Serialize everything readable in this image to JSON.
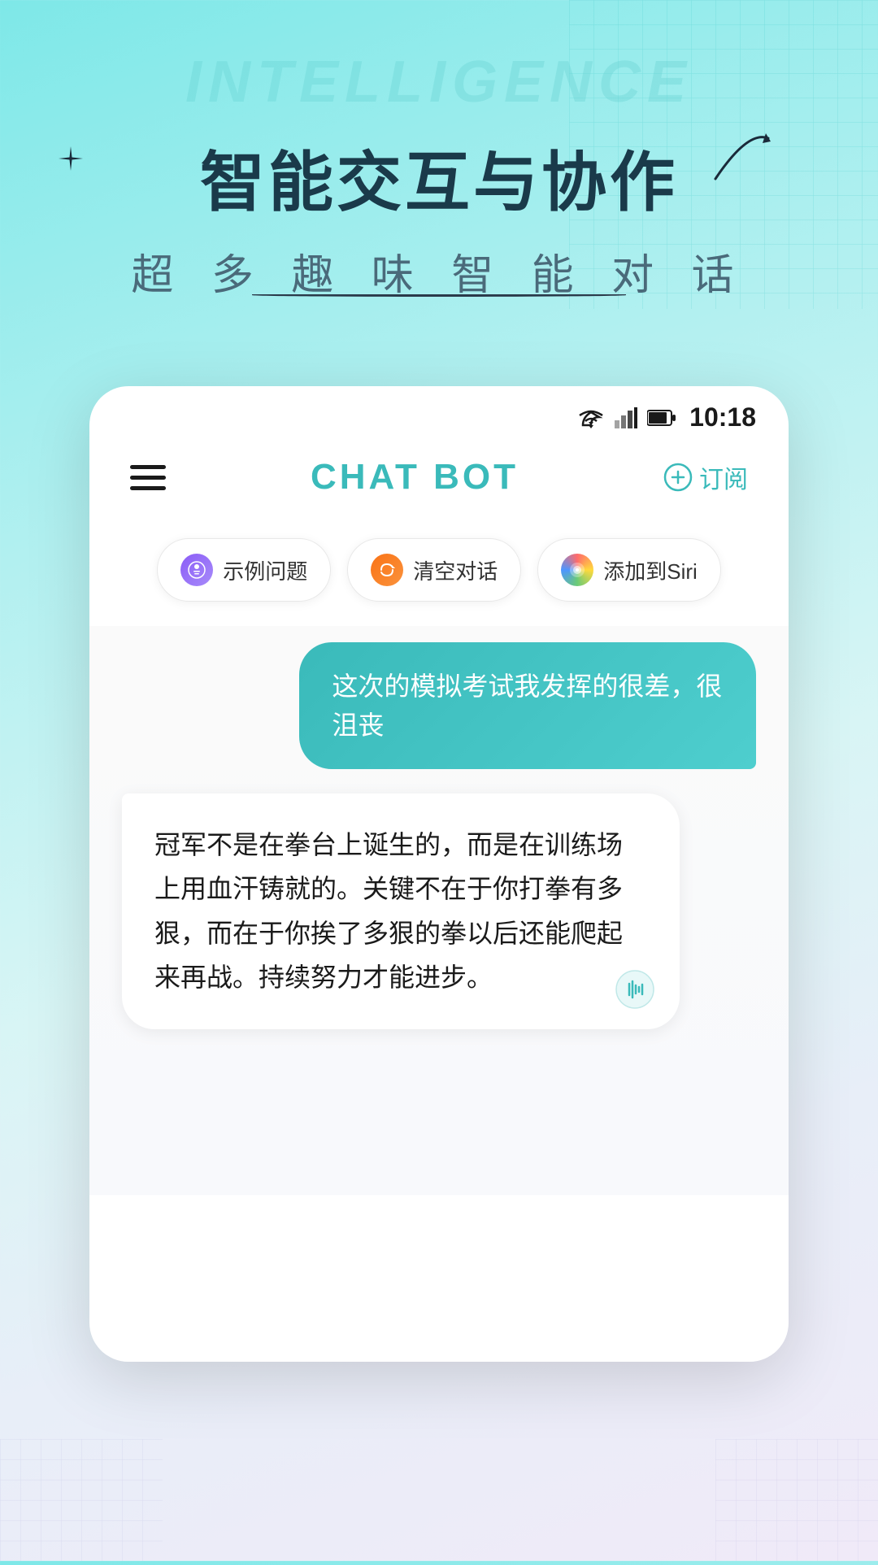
{
  "background": {
    "watermark": "INTELLIGENCE",
    "colors": {
      "bg_start": "#7ee8e8",
      "bg_end": "#f0eaf8",
      "teal": "#3ababa"
    }
  },
  "hero": {
    "main_title": "智能交互与协作",
    "subtitle": "超 多 趣 味 智 能 对 话"
  },
  "status_bar": {
    "time": "10:18"
  },
  "header": {
    "title": "CHAT BOT",
    "subscribe_icon": "+",
    "subscribe_label": "订阅"
  },
  "quick_actions": [
    {
      "id": "example",
      "icon": "🤖",
      "label": "示例问题",
      "icon_bg": "purple"
    },
    {
      "id": "clear",
      "icon": "🔄",
      "label": "清空对话",
      "icon_bg": "orange"
    },
    {
      "id": "siri",
      "icon": "◉",
      "label": "添加到Siri",
      "icon_bg": "siri"
    }
  ],
  "messages": [
    {
      "type": "user",
      "text": "这次的模拟考试我发挥的很差，很沮丧"
    },
    {
      "type": "bot",
      "text": "冠军不是在拳台上诞生的，而是在训练场上用血汗铸就的。关键不在于你打拳有多狠，而在于你挨了多狠的拳以后还能爬起来再战。持续努力才能进步。"
    }
  ]
}
